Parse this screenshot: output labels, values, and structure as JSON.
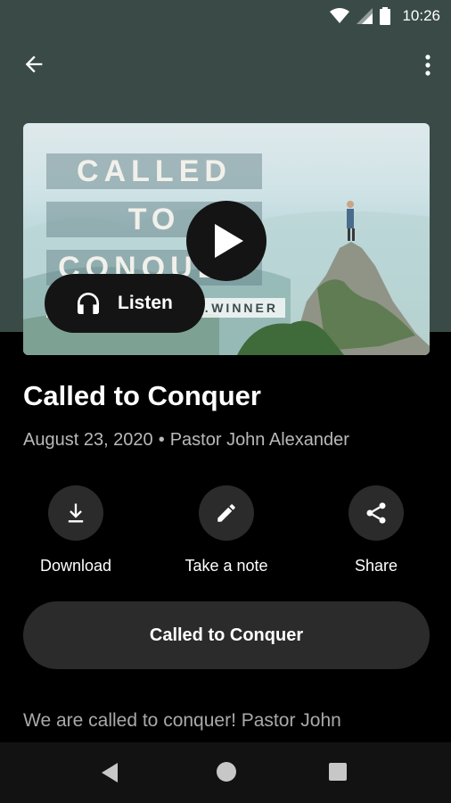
{
  "status_bar": {
    "time": "10:26"
  },
  "hero": {
    "lines": [
      "CALLED",
      "TO",
      "CONQUER"
    ],
    "subtitle": "LIV…WINNER",
    "listen_label": "Listen"
  },
  "sermon": {
    "title": "Called to Conquer",
    "date": "August 23, 2020",
    "separator": "•",
    "speaker": "Pastor John Alexander"
  },
  "actions": [
    {
      "label": "Download",
      "icon": "download-icon"
    },
    {
      "label": "Take a note",
      "icon": "pencil-icon"
    },
    {
      "label": "Share",
      "icon": "share-icon"
    }
  ],
  "series_button": {
    "label": "Called to Conquer"
  },
  "description": {
    "text": "We are called to conquer! Pastor John"
  },
  "colors": {
    "header": "#3a4b47",
    "background": "#000000",
    "button": "#2b2b2b"
  }
}
